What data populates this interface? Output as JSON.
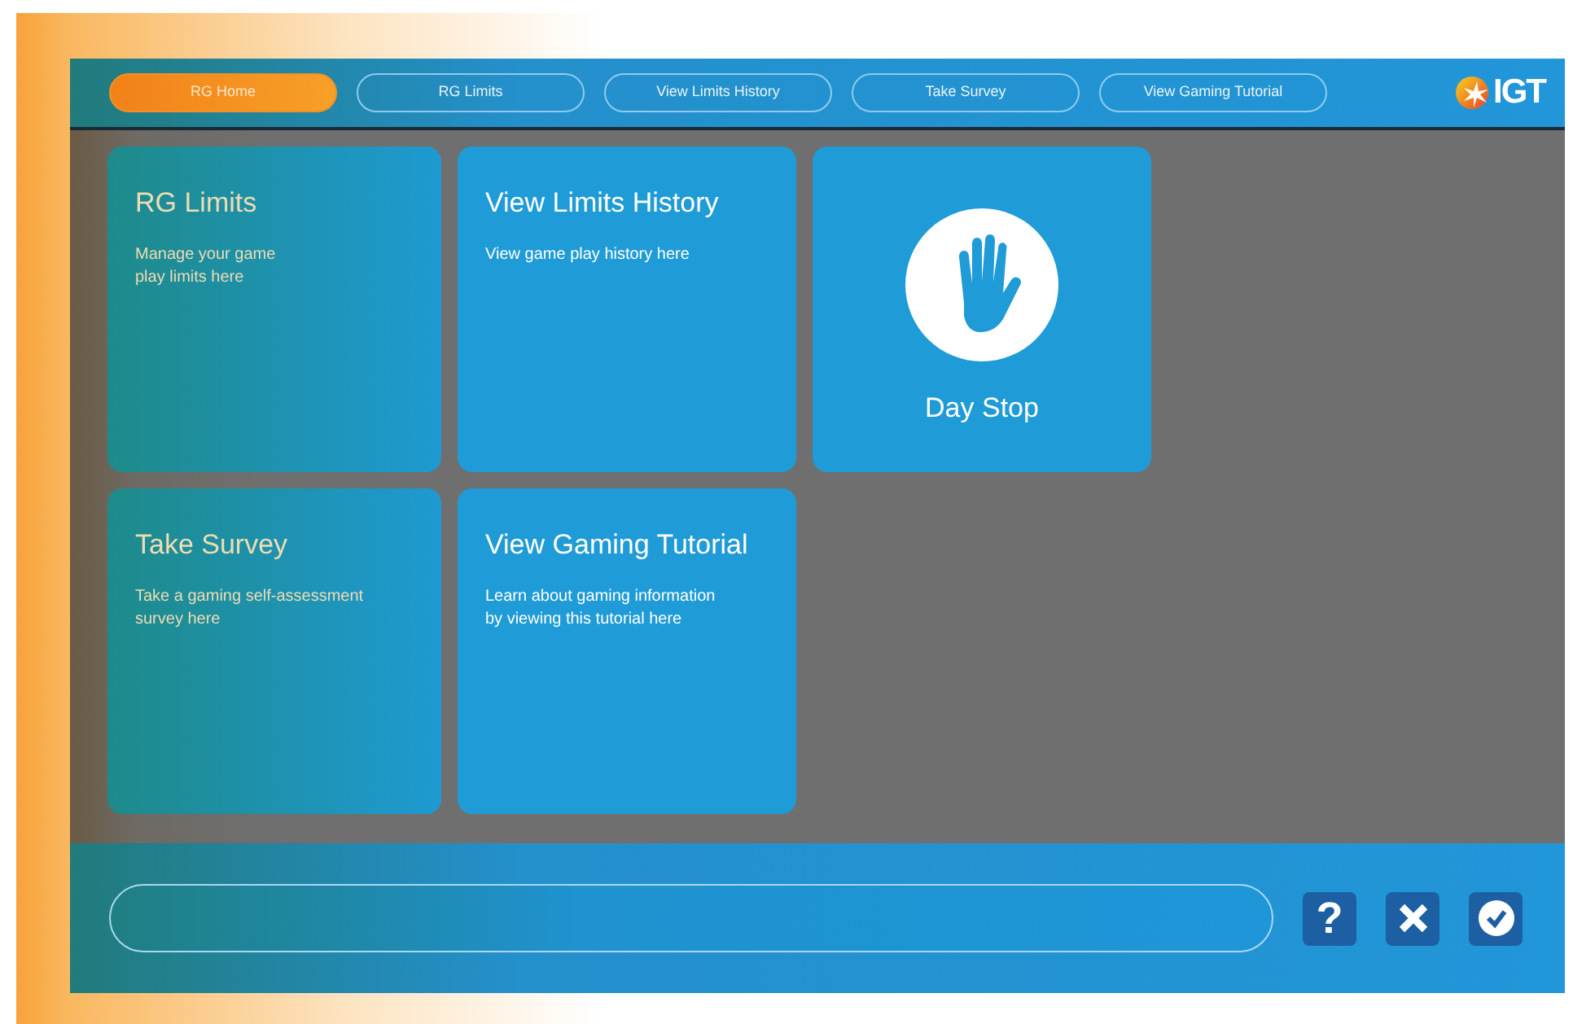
{
  "nav_tabs": [
    {
      "label": "RG Home",
      "selected": true
    },
    {
      "label": "RG Limits",
      "selected": false
    },
    {
      "label": "View Limits History",
      "selected": false
    },
    {
      "label": "Take Survey",
      "selected": false
    },
    {
      "label": "View Gaming Tutorial",
      "selected": false
    }
  ],
  "logo": {
    "text": "IGT"
  },
  "tiles": [
    {
      "kind": "info",
      "title": "RG Limits",
      "description": "Manage your game\nplay limits here"
    },
    {
      "kind": "info",
      "title": "View Limits History",
      "description": "View game play history here"
    },
    {
      "kind": "action",
      "title": "Day Stop"
    },
    {
      "kind": "info",
      "title": "Take Survey",
      "description": "Take a gaming self-assessment\nsurvey here"
    },
    {
      "kind": "info",
      "title": "View Gaming Tutorial",
      "description": "Learn about gaming information\nby viewing this tutorial here"
    }
  ],
  "footer_buttons": [
    {
      "kind": "help",
      "label": "?"
    },
    {
      "kind": "close"
    },
    {
      "kind": "confirm"
    }
  ]
}
